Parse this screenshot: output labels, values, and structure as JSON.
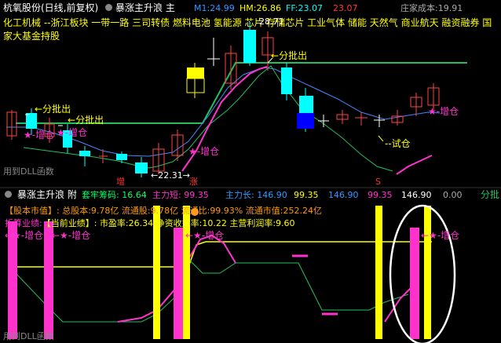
{
  "header": {
    "stock_title": "杭氧股份(日线,前复权)",
    "indicator_title": "暴涨主升浪 主",
    "m1_label": "M1:",
    "m1_value": "24.99",
    "hm_label": "HM:",
    "hm_value": "26.86",
    "ff_label": "FF:",
    "ff_value": "23.07",
    "close_value": "23.07",
    "cost_label": "庄家成本:",
    "cost_value": "19.91"
  },
  "concepts_line1": "化工机械 --浙江板块 一带一路 三司转债 燃料电池 氢能源 芯片 存储芯片 工业气体 储能 天然气 商业航天 融资融券 国",
  "concepts_line2": "家大基金持股",
  "main_chart": {
    "labels": {
      "fenpichu_1": "分批出",
      "fenpichu_2": "分批出",
      "fenpichu_3": "分批出",
      "zengcang_1": "增仓",
      "zengcang_2": "增仓",
      "zengcang_3": "增仓",
      "zengcang_4": "增仓",
      "shicang": "试仓",
      "low_price": "22.31",
      "high_price": "28.71",
      "zeng": "增",
      "zhang": "涨",
      "s_mark": "S"
    },
    "dll_label": "用到DLL函数",
    "colors": {
      "up": "#ff4444",
      "down": "#00ffff",
      "green": "#20c060",
      "magenta": "#ff33cc"
    }
  },
  "sub_header": {
    "title": "暴涨主升浪 附",
    "chip_label": "套牢筹码:",
    "chip_value": "16.64",
    "zlduan_label": "主力短:",
    "zlduan_value": "99.35",
    "zlchang_label": "主力长:",
    "zlchang_value": "146.90",
    "v1": "99.35",
    "v2": "146.90",
    "v3": "99.35",
    "v4": "146.90",
    "v5": "0.00",
    "right_label": "分批"
  },
  "sub_panel": {
    "line1_label": "【股本市值】:",
    "line1_text": "总股本:9.78亿 流通股:9.78亿 流通比:99.93% 流通市值:252.24亿",
    "line2_label": "折算业绩:",
    "line2_bracket": "【当前业绩】:",
    "line2_text": "市盈率:26.34 净资收益率:10.22 主营利润率:9.60",
    "zengcang_a": "增仓",
    "zengcang_b": "增仓",
    "zengcang_c": "增仓",
    "zengcang_d": "增仓",
    "dll_label": "用到DLL函数"
  }
}
